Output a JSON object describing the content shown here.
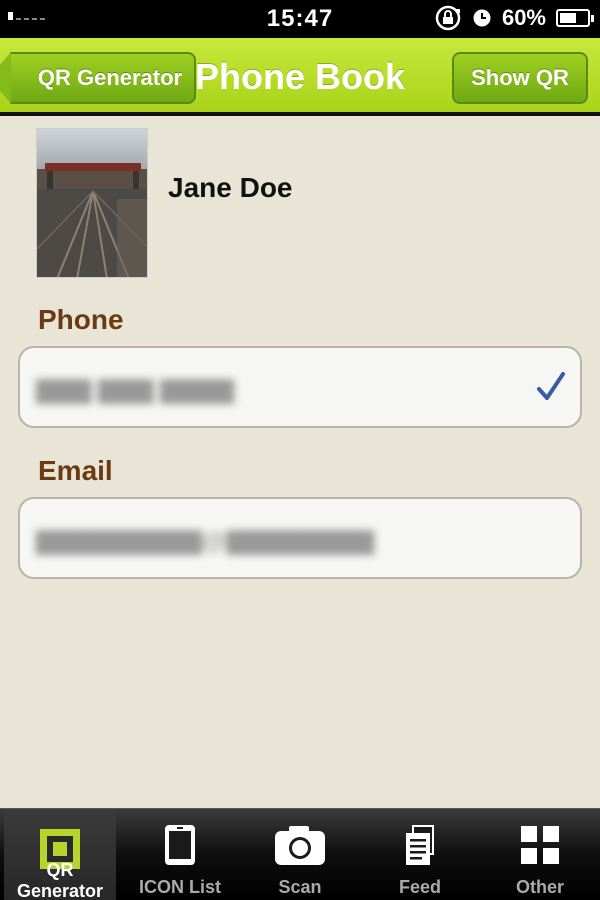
{
  "status_bar": {
    "time": "15:47",
    "battery_text": "60%",
    "battery_level": 0.6,
    "icons": [
      "signal-icon",
      "rotation-lock-icon",
      "alarm-icon",
      "battery-icon"
    ]
  },
  "nav": {
    "back_label": "QR Generator",
    "title": "Phone Book",
    "show_qr_label": "Show QR",
    "accent_color": "#a9d21a"
  },
  "contact": {
    "name": "Jane Doe"
  },
  "phone": {
    "label": "Phone",
    "value": "▇▇▇ ▇▇▇ ▇▇▇▇",
    "selected": true
  },
  "email": {
    "label": "Email",
    "value": "▇▇▇▇▇▇▇▇▇@▇▇▇▇▇▇▇▇"
  },
  "tab_bar": {
    "active_index": 0,
    "tabs": [
      {
        "label": "QR Generator",
        "icon": "qr-square-icon"
      },
      {
        "label": "ICON List",
        "icon": "tablet-icon"
      },
      {
        "label": "Scan",
        "icon": "camera-icon"
      },
      {
        "label": "Feed",
        "icon": "documents-icon"
      },
      {
        "label": "Other",
        "icon": "grid-icon"
      }
    ]
  }
}
